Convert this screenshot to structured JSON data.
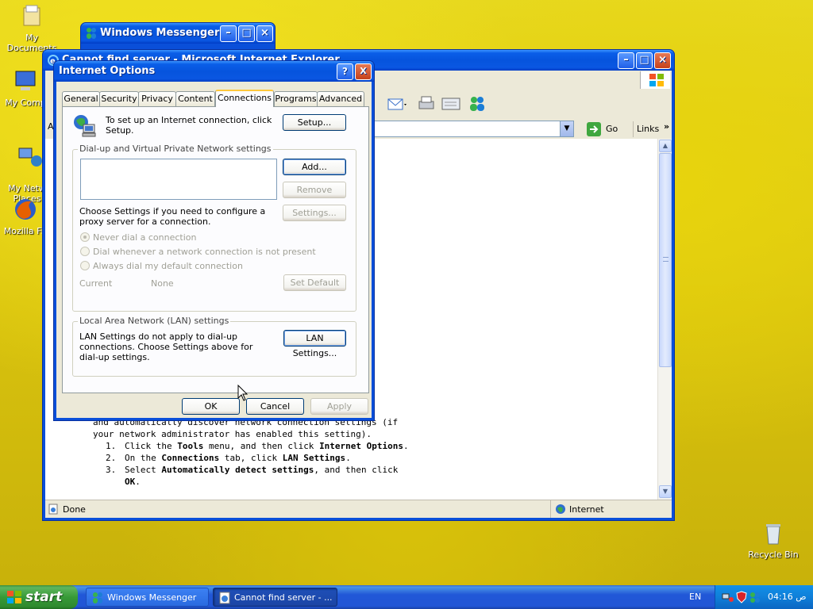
{
  "desktop": {
    "icons": [
      {
        "label": "My Documents"
      },
      {
        "label": "My Comp"
      },
      {
        "label": "My Netw\nPlaces"
      },
      {
        "label": "Mozilla Fir"
      },
      {
        "label": "Recycle Bin"
      }
    ]
  },
  "messenger_window": {
    "title": "Windows Messenger"
  },
  "ie_window": {
    "title": "Cannot find server - Microsoft Internet Explorer",
    "address_prefix": "A",
    "go_label": "Go",
    "links_label": "Links",
    "body_lines": [
      "and automatically discover network connection settings (if",
      "your network administrator has enabled this setting)."
    ],
    "steps": [
      {
        "num": "1.",
        "parts": [
          "Click the ",
          "Tools",
          " menu, and then click ",
          "Internet Options",
          "."
        ]
      },
      {
        "num": "2.",
        "parts": [
          "On the ",
          "Connections",
          " tab, click ",
          "LAN Settings",
          "."
        ]
      },
      {
        "num": "3.",
        "parts": [
          "Select ",
          "Automatically detect settings",
          ", and then click ",
          "OK",
          "."
        ]
      }
    ],
    "status": "Done",
    "zone": "Internet"
  },
  "dialog": {
    "title": "Internet Options",
    "help": "?",
    "close": "X",
    "tabs": [
      "General",
      "Security",
      "Privacy",
      "Content",
      "Connections",
      "Programs",
      "Advanced"
    ],
    "active_tab": "Connections",
    "setup_text": "To set up an Internet connection, click Setup.",
    "setup_button": "Setup...",
    "dialup_group": "Dial-up and Virtual Private Network settings",
    "add_button": "Add...",
    "remove_button": "Remove",
    "settings_text": "Choose Settings if you need to configure a proxy server for a connection.",
    "settings_button": "Settings...",
    "radio_never": "Never dial a connection",
    "radio_whenever": "Dial whenever a network connection is not present",
    "radio_always": "Always dial my default connection",
    "current_label": "Current",
    "current_value": "None",
    "set_default_button": "Set Default",
    "lan_group": "Local Area Network (LAN) settings",
    "lan_text": "LAN Settings do not apply to dial-up connections. Choose Settings above for dial-up settings.",
    "lan_button": "LAN Settings...",
    "ok": "OK",
    "cancel": "Cancel",
    "apply": "Apply"
  },
  "taskbar": {
    "start": "start",
    "tasks": [
      "Windows Messenger",
      "Cannot find server - ..."
    ],
    "lang": "EN",
    "clock": "04:16 ص"
  }
}
